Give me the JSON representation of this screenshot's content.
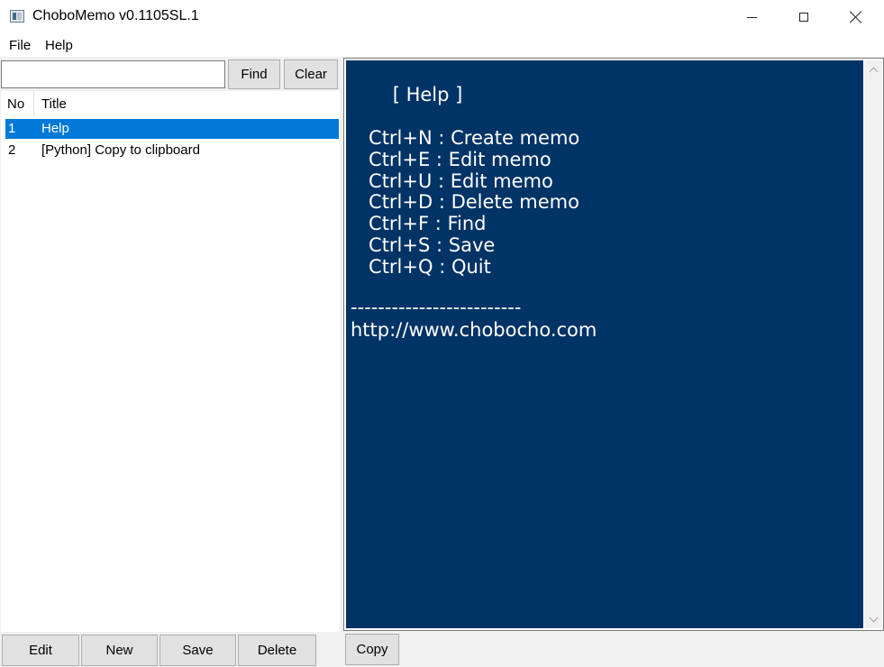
{
  "window": {
    "title": "ChoboMemo v0.1105SL.1"
  },
  "menu": {
    "file": "File",
    "help": "Help"
  },
  "search": {
    "value": "",
    "placeholder": "",
    "find_label": "Find",
    "clear_label": "Clear"
  },
  "list": {
    "header_no": "No",
    "header_title": "Title",
    "rows": [
      {
        "no": "1",
        "title": "Help",
        "selected": true
      },
      {
        "no": "2",
        "title": "[Python] Copy to clipboard",
        "selected": false
      }
    ]
  },
  "buttons": {
    "edit": "Edit",
    "new": "New",
    "save": "Save",
    "delete": "Delete",
    "copy": "Copy"
  },
  "memo": {
    "background": "#003366",
    "text_color": "#ffffff",
    "lines": [
      "       [ Help ]",
      "",
      "   Ctrl+N : Create memo",
      "   Ctrl+E : Edit memo",
      "   Ctrl+U : Edit memo",
      "   Ctrl+D : Delete memo",
      "   Ctrl+F : Find",
      "   Ctrl+S : Save",
      "   Ctrl+Q : Quit",
      "",
      "-------------------------",
      "http://www.chobocho.com"
    ]
  },
  "colors": {
    "selection": "#0078d7",
    "chrome": "#f0f0f0"
  }
}
